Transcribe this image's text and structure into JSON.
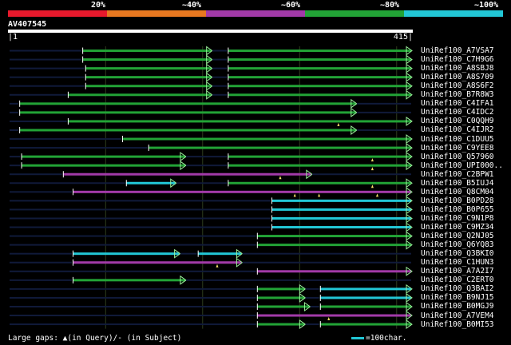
{
  "scale": {
    "labels": [
      "20%",
      "~40%",
      "~60%",
      "~80%",
      "~100%"
    ],
    "colors": [
      "#e8192c",
      "#e87820",
      "#a23aa8",
      "#22a336",
      "#22c7d6"
    ]
  },
  "query": {
    "id": "AV407545",
    "start_label": "1",
    "end_label": "415",
    "length": 415
  },
  "hits": [
    {
      "name": "UniRef100_A7VSA7",
      "segments": [
        {
          "s": 1,
          "e": 75,
          "c": "dim"
        },
        {
          "s": 76,
          "e": 209,
          "c": "green",
          "arrow": true
        },
        {
          "s": 210,
          "e": 225,
          "c": "dim"
        },
        {
          "s": 226,
          "e": 415,
          "c": "green",
          "arrow": true
        }
      ]
    },
    {
      "name": "UniRef100_C7H9G6",
      "segments": [
        {
          "s": 1,
          "e": 75,
          "c": "dim"
        },
        {
          "s": 76,
          "e": 209,
          "c": "green",
          "arrow": true
        },
        {
          "s": 210,
          "e": 225,
          "c": "dim"
        },
        {
          "s": 226,
          "e": 415,
          "c": "green",
          "arrow": true
        }
      ]
    },
    {
      "name": "UniRef100_A8SBJ8",
      "segments": [
        {
          "s": 1,
          "e": 78,
          "c": "dim"
        },
        {
          "s": 79,
          "e": 209,
          "c": "green",
          "arrow": true
        },
        {
          "s": 210,
          "e": 225,
          "c": "dim"
        },
        {
          "s": 226,
          "e": 415,
          "c": "green",
          "arrow": true
        }
      ]
    },
    {
      "name": "UniRef100_A8S709",
      "segments": [
        {
          "s": 1,
          "e": 78,
          "c": "dim"
        },
        {
          "s": 79,
          "e": 209,
          "c": "green",
          "arrow": true
        },
        {
          "s": 210,
          "e": 225,
          "c": "dim"
        },
        {
          "s": 226,
          "e": 415,
          "c": "green",
          "arrow": true
        }
      ]
    },
    {
      "name": "UniRef100_A8S6F2",
      "segments": [
        {
          "s": 1,
          "e": 78,
          "c": "dim"
        },
        {
          "s": 79,
          "e": 209,
          "c": "green",
          "arrow": true
        },
        {
          "s": 210,
          "e": 225,
          "c": "dim"
        },
        {
          "s": 226,
          "e": 415,
          "c": "green",
          "arrow": true
        }
      ]
    },
    {
      "name": "UniRef100_B7R8W3",
      "segments": [
        {
          "s": 1,
          "e": 60,
          "c": "dim"
        },
        {
          "s": 61,
          "e": 209,
          "c": "green",
          "arrow": true
        },
        {
          "s": 210,
          "e": 225,
          "c": "dim"
        },
        {
          "s": 226,
          "e": 415,
          "c": "green",
          "arrow": true
        }
      ]
    },
    {
      "name": "UniRef100_C4IFA1",
      "segments": [
        {
          "s": 1,
          "e": 10,
          "c": "dim"
        },
        {
          "s": 11,
          "e": 358,
          "c": "green",
          "arrow": true
        },
        {
          "s": 359,
          "e": 415,
          "c": "dim"
        }
      ]
    },
    {
      "name": "UniRef100_C4IDC2",
      "segments": [
        {
          "s": 1,
          "e": 10,
          "c": "dim"
        },
        {
          "s": 11,
          "e": 358,
          "c": "green",
          "arrow": true
        },
        {
          "s": 359,
          "e": 415,
          "c": "dim"
        }
      ]
    },
    {
      "name": "UniRef100_C0QQH9",
      "segments": [
        {
          "s": 1,
          "e": 60,
          "c": "dim"
        },
        {
          "s": 61,
          "e": 415,
          "c": "green",
          "arrow": true
        }
      ],
      "marks": [
        340
      ]
    },
    {
      "name": "UniRef100_C4IJR2",
      "segments": [
        {
          "s": 1,
          "e": 10,
          "c": "dim"
        },
        {
          "s": 11,
          "e": 358,
          "c": "green",
          "arrow": true
        },
        {
          "s": 359,
          "e": 415,
          "c": "dim"
        }
      ]
    },
    {
      "name": "UniRef100_C1DUU5",
      "segments": [
        {
          "s": 1,
          "e": 116,
          "c": "dim"
        },
        {
          "s": 117,
          "e": 415,
          "c": "green",
          "arrow": true
        }
      ]
    },
    {
      "name": "UniRef100_C9YEE8",
      "segments": [
        {
          "s": 1,
          "e": 143,
          "c": "dim"
        },
        {
          "s": 144,
          "e": 415,
          "c": "green",
          "arrow": true
        }
      ]
    },
    {
      "name": "UniRef100_Q57960",
      "segments": [
        {
          "s": 1,
          "e": 12,
          "c": "dim"
        },
        {
          "s": 13,
          "e": 182,
          "c": "green",
          "arrow": true
        },
        {
          "s": 183,
          "e": 225,
          "c": "dim"
        },
        {
          "s": 226,
          "e": 415,
          "c": "green",
          "arrow": true
        }
      ],
      "marks": [
        375
      ]
    },
    {
      "name": "UniRef100_UPI000..",
      "segments": [
        {
          "s": 1,
          "e": 12,
          "c": "dim"
        },
        {
          "s": 13,
          "e": 182,
          "c": "green",
          "arrow": true
        },
        {
          "s": 183,
          "e": 225,
          "c": "dim"
        },
        {
          "s": 226,
          "e": 415,
          "c": "green",
          "arrow": true
        }
      ],
      "marks": [
        375
      ]
    },
    {
      "name": "UniRef100_C2BPW1",
      "segments": [
        {
          "s": 1,
          "e": 55,
          "c": "dim"
        },
        {
          "s": 56,
          "e": 312,
          "c": "magenta",
          "arrow": true
        },
        {
          "s": 313,
          "e": 415,
          "c": "dim"
        }
      ],
      "marks": [
        280
      ]
    },
    {
      "name": "UniRef100_B5IUJ4",
      "segments": [
        {
          "s": 1,
          "e": 120,
          "c": "dim"
        },
        {
          "s": 121,
          "e": 172,
          "c": "cyan",
          "arrow": true
        },
        {
          "s": 173,
          "e": 225,
          "c": "dim"
        },
        {
          "s": 226,
          "e": 415,
          "c": "green",
          "arrow": true
        }
      ],
      "marks": [
        375
      ]
    },
    {
      "name": "UniRef100_Q8CM04",
      "segments": [
        {
          "s": 1,
          "e": 65,
          "c": "dim"
        },
        {
          "s": 66,
          "e": 415,
          "c": "magenta",
          "arrow": true
        }
      ],
      "marks": [
        295,
        320,
        380
      ]
    },
    {
      "name": "UniRef100_B0PD28",
      "segments": [
        {
          "s": 1,
          "e": 270,
          "c": "dim"
        },
        {
          "s": 271,
          "e": 415,
          "c": "cyan",
          "arrow": true
        }
      ]
    },
    {
      "name": "UniRef100_B0P655",
      "segments": [
        {
          "s": 1,
          "e": 270,
          "c": "dim"
        },
        {
          "s": 271,
          "e": 415,
          "c": "cyan",
          "arrow": true
        }
      ]
    },
    {
      "name": "UniRef100_C9N1P8",
      "segments": [
        {
          "s": 1,
          "e": 270,
          "c": "dim"
        },
        {
          "s": 271,
          "e": 415,
          "c": "cyan",
          "arrow": true
        }
      ]
    },
    {
      "name": "UniRef100_C9MZ34",
      "segments": [
        {
          "s": 1,
          "e": 270,
          "c": "dim"
        },
        {
          "s": 271,
          "e": 415,
          "c": "cyan",
          "arrow": true
        }
      ]
    },
    {
      "name": "UniRef100_Q2NJ05",
      "segments": [
        {
          "s": 1,
          "e": 255,
          "c": "dim"
        },
        {
          "s": 256,
          "e": 415,
          "c": "green",
          "arrow": true
        }
      ]
    },
    {
      "name": "UniRef100_Q6YQ83",
      "segments": [
        {
          "s": 1,
          "e": 255,
          "c": "dim"
        },
        {
          "s": 256,
          "e": 415,
          "c": "green",
          "arrow": true
        }
      ]
    },
    {
      "name": "UniRef100_Q3BKI0",
      "segments": [
        {
          "s": 1,
          "e": 65,
          "c": "dim"
        },
        {
          "s": 66,
          "e": 176,
          "c": "cyan",
          "arrow": true
        },
        {
          "s": 177,
          "e": 194,
          "c": "dim"
        },
        {
          "s": 195,
          "e": 240,
          "c": "cyan",
          "arrow": true
        },
        {
          "s": 241,
          "e": 415,
          "c": "dim"
        }
      ]
    },
    {
      "name": "UniRef100_C1HUN3",
      "segments": [
        {
          "s": 1,
          "e": 65,
          "c": "dim"
        },
        {
          "s": 66,
          "e": 240,
          "c": "magenta",
          "arrow": true
        },
        {
          "s": 241,
          "e": 415,
          "c": "dim"
        }
      ],
      "marks": [
        215
      ]
    },
    {
      "name": "UniRef100_A7A2I7",
      "segments": [
        {
          "s": 1,
          "e": 255,
          "c": "dim"
        },
        {
          "s": 256,
          "e": 415,
          "c": "magenta",
          "arrow": true
        }
      ]
    },
    {
      "name": "UniRef100_C2ERT0",
      "segments": [
        {
          "s": 1,
          "e": 65,
          "c": "dim"
        },
        {
          "s": 66,
          "e": 182,
          "c": "green",
          "arrow": true
        },
        {
          "s": 183,
          "e": 415,
          "c": "dim"
        }
      ]
    },
    {
      "name": "UniRef100_Q3BAI2",
      "segments": [
        {
          "s": 1,
          "e": 255,
          "c": "dim"
        },
        {
          "s": 256,
          "e": 305,
          "c": "green",
          "arrow": true
        },
        {
          "s": 306,
          "e": 320,
          "c": "dim"
        },
        {
          "s": 321,
          "e": 415,
          "c": "cyan",
          "arrow": true
        }
      ]
    },
    {
      "name": "UniRef100_B9NJ15",
      "segments": [
        {
          "s": 1,
          "e": 255,
          "c": "dim"
        },
        {
          "s": 256,
          "e": 305,
          "c": "green",
          "arrow": true
        },
        {
          "s": 306,
          "e": 320,
          "c": "dim"
        },
        {
          "s": 321,
          "e": 415,
          "c": "cyan",
          "arrow": true
        }
      ]
    },
    {
      "name": "UniRef100_B0MGJ9",
      "segments": [
        {
          "s": 1,
          "e": 255,
          "c": "dim"
        },
        {
          "s": 256,
          "e": 310,
          "c": "green",
          "arrow": true
        },
        {
          "s": 311,
          "e": 320,
          "c": "dim"
        },
        {
          "s": 321,
          "e": 415,
          "c": "green",
          "arrow": true
        }
      ]
    },
    {
      "name": "UniRef100_A7VEM4",
      "segments": [
        {
          "s": 1,
          "e": 255,
          "c": "dim"
        },
        {
          "s": 256,
          "e": 415,
          "c": "magenta",
          "arrow": true
        }
      ],
      "marks": [
        330
      ]
    },
    {
      "name": "UniRef100_B0MI53",
      "segments": [
        {
          "s": 1,
          "e": 255,
          "c": "dim"
        },
        {
          "s": 256,
          "e": 305,
          "c": "green",
          "arrow": true
        },
        {
          "s": 306,
          "e": 320,
          "c": "dim"
        },
        {
          "s": 321,
          "e": 415,
          "c": "green",
          "arrow": true
        }
      ]
    }
  ],
  "colors": {
    "green": "#22a336",
    "magenta": "#a23aa8",
    "cyan": "#22c7d6",
    "dim": "#101a3a",
    "arrow": "#9cf29c",
    "mark": "#f7e06b",
    "grid": "#2e3d1e"
  },
  "legend": {
    "left_text": "Large gaps: ▲(in Query)/- (in Subject)",
    "right_text": "=100char."
  }
}
